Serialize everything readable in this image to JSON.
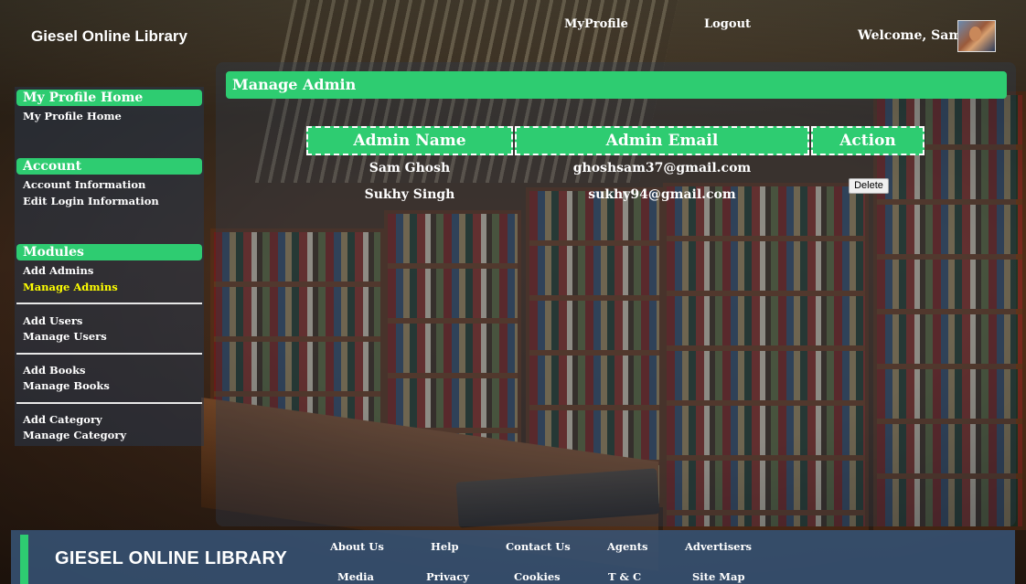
{
  "header": {
    "site_title": "Giesel Online Library",
    "nav": [
      "MyProfile",
      "Logout"
    ],
    "welcome": "Welcome, Sam"
  },
  "sidebar": {
    "profile_heading": "My Profile Home",
    "profile_links": [
      "My Profile Home"
    ],
    "account_heading": "Account",
    "account_links": [
      "Account Information",
      "Edit Login Information"
    ],
    "modules_heading": "Modules",
    "module_links": [
      "Add Admins",
      "Manage Admins",
      "Add Users",
      "Manage Users",
      "Add Books",
      "Manage Books",
      "Add Category",
      "Manage Category"
    ],
    "active_link": "Manage Admins",
    "active_color": "#ffff00"
  },
  "main": {
    "title": "Manage Admin",
    "columns": [
      "Admin Name",
      "Admin Email",
      "Action"
    ],
    "rows": [
      {
        "name": "Sam Ghosh",
        "email": "ghoshsam37@gmail.com",
        "action": ""
      },
      {
        "name": "Sukhy Singh",
        "email": "sukhy94@gmail.com",
        "action": "Delete"
      }
    ]
  },
  "footer": {
    "brand": "GIESEL ONLINE LIBRARY",
    "links_row1": [
      "About Us",
      "Help",
      "Contact Us",
      "Agents",
      "Advertisers"
    ],
    "links_row2": [
      "Media",
      "Privacy",
      "Cookies",
      "T & C",
      "Site Map"
    ]
  },
  "colors": {
    "accent": "#2ecc71",
    "sidebar_bg": "#2a3a50",
    "footer_bg": "#375578"
  },
  "icons": {
    "avatar": "user-avatar-photo"
  }
}
